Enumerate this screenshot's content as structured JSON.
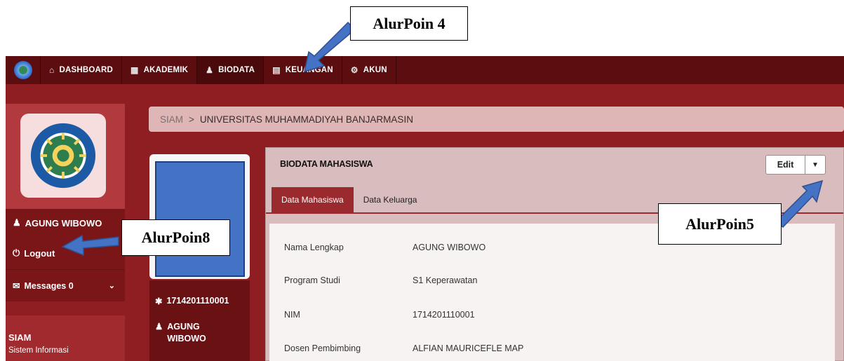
{
  "annotations": {
    "alurpoin4": "AlurPoin 4",
    "alurpoin5": "AlurPoin5",
    "alurpoin8": "AlurPoin8"
  },
  "navbar": {
    "items": [
      {
        "label": "DASHBOARD",
        "icon": "home-icon"
      },
      {
        "label": "AKADEMIK",
        "icon": "grid-icon"
      },
      {
        "label": "BIODATA",
        "icon": "user-icon"
      },
      {
        "label": "KEUANGAN",
        "icon": "money-icon"
      },
      {
        "label": "AKUN",
        "icon": "gears-icon"
      }
    ]
  },
  "breadcrumb": {
    "root": "SIAM",
    "separator": ">",
    "current": "UNIVERSITAS MUHAMMADIYAH BANJARMASIN"
  },
  "sidebar": {
    "user_name": "AGUNG WIBOWO",
    "logout": "Logout",
    "messages": "Messages 0",
    "app_short": "SIAM",
    "app_long": "Sistem Informasi"
  },
  "profile_card": {
    "nim": "1714201110001",
    "name_line1": "AGUNG",
    "name_line2": "WIBOWO"
  },
  "panel": {
    "title": "BIODATA MAHASISWA",
    "edit_label": "Edit",
    "tabs": [
      "Data Mahasiswa",
      "Data Keluarga"
    ],
    "rows": [
      {
        "label": "Nama Lengkap",
        "value": "AGUNG WIBOWO"
      },
      {
        "label": "Program Studi",
        "value": "S1 Keperawatan"
      },
      {
        "label": "NIM",
        "value": "1714201110001"
      },
      {
        "label": "Dosen Pembimbing",
        "value": "ALFIAN MAURICEFLE MAP"
      }
    ]
  },
  "colors": {
    "navbar": "#5c0d10",
    "page_bg": "#8f1e22",
    "panel_bg": "#d9bdbe",
    "arrow": "#4472c4"
  }
}
